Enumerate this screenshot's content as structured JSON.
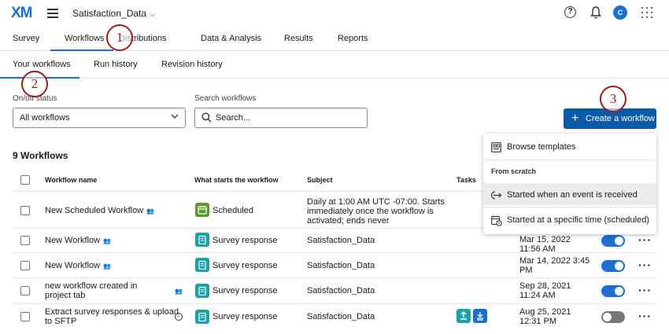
{
  "header": {
    "logo": "XM",
    "project_name": "Satisfaction_Data",
    "help_symbol": "?",
    "avatar_initial": "C"
  },
  "nav_primary": {
    "tabs": [
      "Survey",
      "Workflows",
      "Distributions",
      "Data & Analysis",
      "Results",
      "Reports"
    ],
    "active": "Workflows"
  },
  "nav_secondary": {
    "tabs": [
      "Your workflows",
      "Run history",
      "Revision history"
    ],
    "active": "Your workflows"
  },
  "callouts": [
    "1",
    "2",
    "3"
  ],
  "filters": {
    "status_label": "On/off status",
    "status_value": "All workflows",
    "search_label": "Search workflows",
    "search_placeholder": "Search..."
  },
  "create_button": "Create a workflow",
  "workflow_count": "9 Workflows",
  "table": {
    "headers": [
      "Workflow name",
      "What starts the workflow",
      "Subject",
      "Tasks"
    ],
    "rows": [
      {
        "name": "New Scheduled Workflow",
        "trigger": "Scheduled",
        "subject": "Daily at 1:00 AM UTC -07:00. Starts immediately once the workflow is activated; ends never",
        "modified": "",
        "enabled": true
      },
      {
        "name": "New Workflow",
        "trigger": "Survey response",
        "subject": "Satisfaction_Data",
        "modified": "Mar 15, 2022 11:56 AM",
        "enabled": true
      },
      {
        "name": "New Workflow",
        "trigger": "Survey response",
        "subject": "Satisfaction_Data",
        "modified": "Mar 14, 2022 3:45 PM",
        "enabled": true
      },
      {
        "name": "new workflow created in project tab",
        "trigger": "Survey response",
        "subject": "Satisfaction_Data",
        "modified": "Sep 28, 2021 11:24 AM",
        "enabled": true
      },
      {
        "name": "Extract survey responses & upload to SFTP",
        "trigger": "Survey response",
        "subject": "Satisfaction_Data",
        "modified": "Aug 25, 2021 12:31 PM",
        "enabled": false
      }
    ]
  },
  "dropdown": {
    "browse": "Browse templates",
    "section": "From scratch",
    "event": "Started when an event is received",
    "scheduled": "Started at a specific time (scheduled)"
  },
  "colors": {
    "accent": "#1a6fd1",
    "button": "#0b5aa6",
    "callout": "#9c1c1c",
    "scheduled_icon": "#5a9a2d",
    "survey_icon": "#1aa2a8"
  }
}
